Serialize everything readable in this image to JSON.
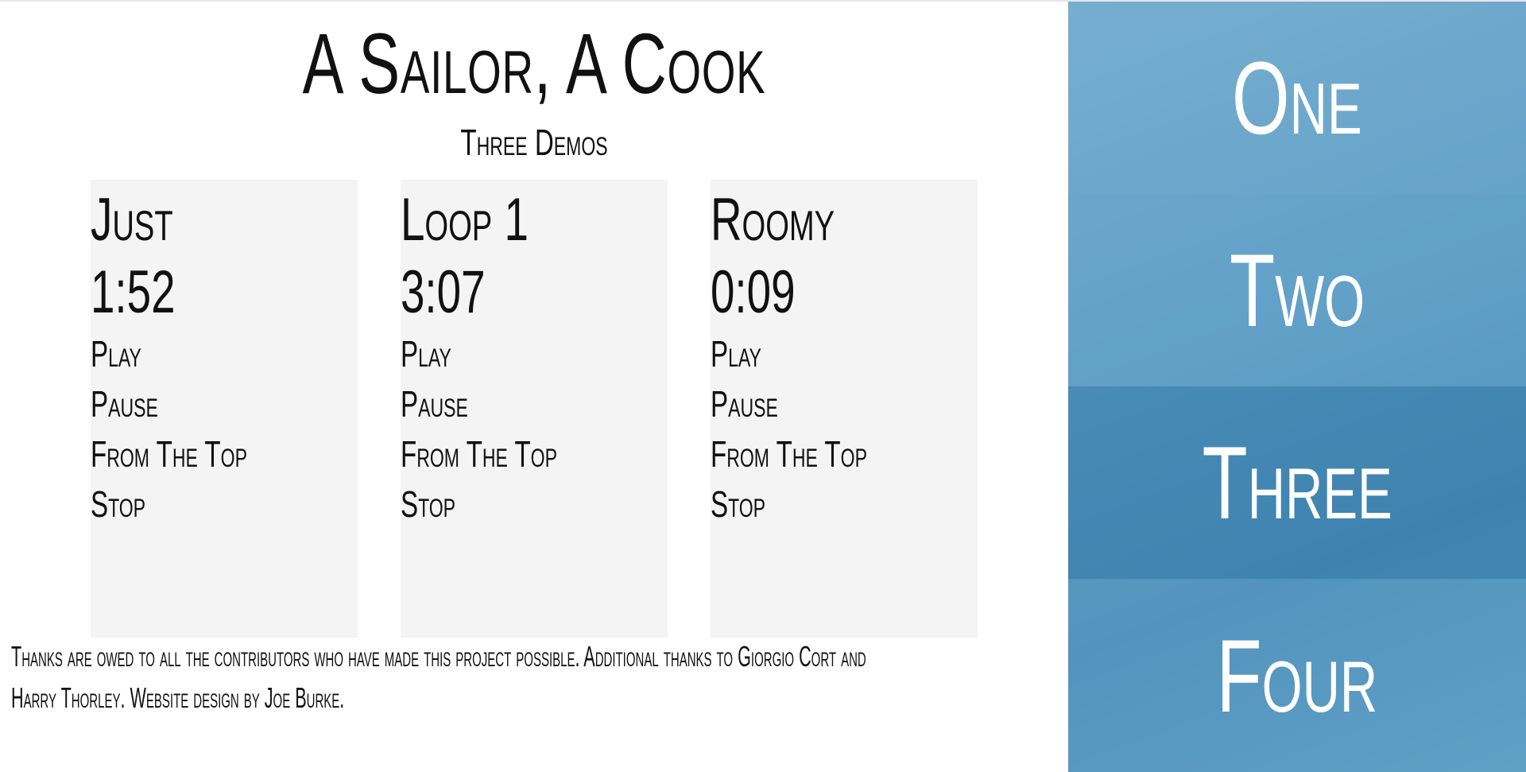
{
  "header": {
    "title": "A Sailor, A Cook",
    "subtitle": "Three Demos"
  },
  "tracks": [
    {
      "title": "Just",
      "duration": "1:52",
      "controls": {
        "play": "Play",
        "pause": "Pause",
        "from_top": "From The Top",
        "stop": "Stop"
      }
    },
    {
      "title": "Loop 1",
      "duration": "3:07",
      "controls": {
        "play": "Play",
        "pause": "Pause",
        "from_top": "From The Top",
        "stop": "Stop"
      }
    },
    {
      "title": "Roomy",
      "duration": "0:09",
      "controls": {
        "play": "Play",
        "pause": "Pause",
        "from_top": "From The Top",
        "stop": "Stop"
      }
    }
  ],
  "footer": {
    "text": "Thanks are owed to all the contributors who have made this project possible. Additional thanks to Giorgio Cort and Harry Thorley. Website design by Joe Burke."
  },
  "sidebar": {
    "panels": [
      {
        "label": "One"
      },
      {
        "label": "Two"
      },
      {
        "label": "Three"
      },
      {
        "label": "Four"
      }
    ]
  },
  "colors": {
    "sky_blue": "#5b9bc3",
    "card_bg": "#f4f4f4",
    "text": "#111111"
  }
}
